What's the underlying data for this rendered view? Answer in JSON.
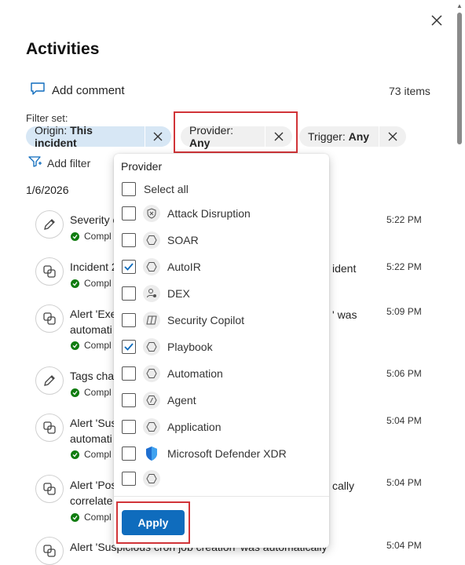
{
  "panel": {
    "title": "Activities",
    "add_comment": "Add comment",
    "items_count": "73 items",
    "filter_set_label": "Filter set:",
    "add_filter": "Add filter",
    "date": "1/6/2026"
  },
  "chips": [
    {
      "key": "Origin:",
      "value": "This incident"
    },
    {
      "key": "Provider:",
      "value": "Any"
    },
    {
      "key": "Trigger:",
      "value": "Any"
    }
  ],
  "rows": [
    {
      "icon": "pencil-icon",
      "line1": "Severity c",
      "line2": "",
      "status": "Compl",
      "right1": "",
      "right2": "",
      "time": "5:22 PM"
    },
    {
      "icon": "copy-icon",
      "line1": "Incident 2",
      "line2": "",
      "status": "Compl",
      "right1": "ident",
      "right2": "",
      "time": "5:22 PM"
    },
    {
      "icon": "copy-icon",
      "line1": "Alert 'Exe",
      "line2": "automati",
      "status": "Compl",
      "right1": "' was",
      "right2": "",
      "time": "5:09 PM"
    },
    {
      "icon": "pencil-icon",
      "line1": "Tags char",
      "line2": "",
      "status": "Compl",
      "right1": "",
      "right2": "",
      "time": "5:06 PM"
    },
    {
      "icon": "copy-icon",
      "line1": "Alert 'Sus",
      "line2": "automati",
      "status": "Compl",
      "right1": "",
      "right2": "",
      "time": "5:04 PM"
    },
    {
      "icon": "copy-icon",
      "line1": "Alert 'Pos",
      "line2": "correlate",
      "status": "Compl",
      "right1": "cally",
      "right2": "",
      "time": "5:04 PM"
    },
    {
      "icon": "copy-icon",
      "line1": "Alert 'Suspicious cron job creation' was automatically",
      "line2": "",
      "status": "",
      "right1": "",
      "right2": "",
      "time": "5:04 PM"
    }
  ],
  "dropdown": {
    "heading": "Provider",
    "select_all": "Select all",
    "options": [
      {
        "label": "Attack Disruption",
        "checked": false,
        "icon": "shield-x-icon"
      },
      {
        "label": "SOAR",
        "checked": false,
        "icon": "hexagon-icon"
      },
      {
        "label": "AutoIR",
        "checked": true,
        "icon": "hexagon-icon"
      },
      {
        "label": "DEX",
        "checked": false,
        "icon": "person-gear-icon"
      },
      {
        "label": "Security Copilot",
        "checked": false,
        "icon": "copilot-icon"
      },
      {
        "label": "Playbook",
        "checked": true,
        "icon": "hexagon-icon"
      },
      {
        "label": "Automation",
        "checked": false,
        "icon": "hexagon-icon"
      },
      {
        "label": "Agent",
        "checked": false,
        "icon": "agent-icon"
      },
      {
        "label": "Application",
        "checked": false,
        "icon": "hexagon-icon"
      },
      {
        "label": "Microsoft Defender XDR",
        "checked": false,
        "icon": "defender-shield-icon"
      },
      {
        "label": "",
        "checked": false,
        "icon": "hexagon-icon"
      }
    ],
    "apply": "Apply"
  },
  "colors": {
    "accent": "#0f6cbd",
    "highlight_box": "#d13438",
    "origin_chip": "#d7e7f5",
    "success": "#107c10"
  }
}
